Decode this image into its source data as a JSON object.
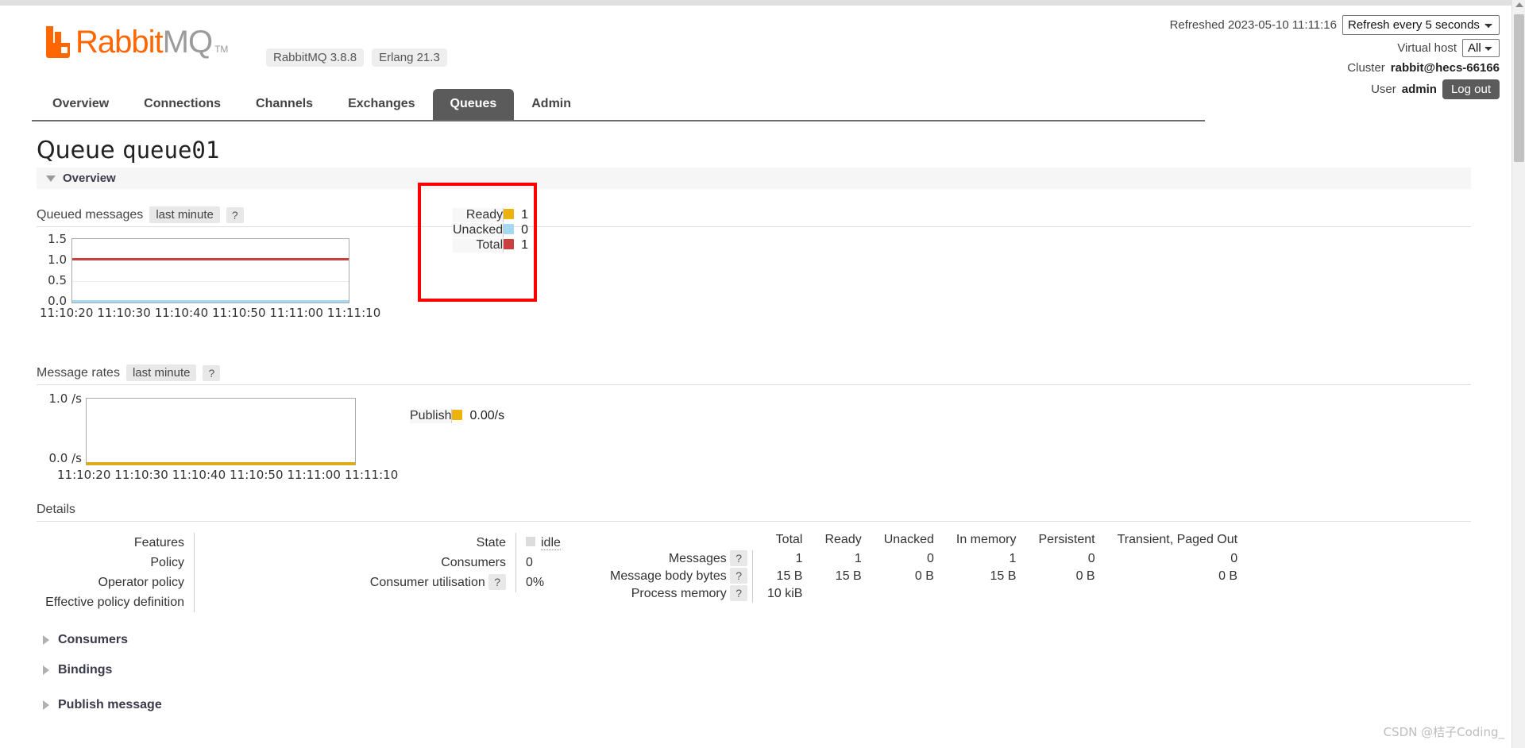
{
  "header": {
    "brand_rabbit": "Rabbit",
    "brand_mq": "MQ",
    "trademark": "TM",
    "version_pill": "RabbitMQ 3.8.8",
    "erlang_pill": "Erlang 21.3",
    "refreshed_label": "Refreshed 2023-05-10 11:11:16",
    "refresh_select_value": "Refresh every 5 seconds",
    "vhost_label": "Virtual host",
    "vhost_value": "All",
    "cluster_label": "Cluster",
    "cluster_value": "rabbit@hecs-66166",
    "user_label": "User",
    "user_value": "admin",
    "logout_label": "Log out"
  },
  "nav": {
    "tabs": [
      {
        "label": "Overview",
        "active": false
      },
      {
        "label": "Connections",
        "active": false
      },
      {
        "label": "Channels",
        "active": false
      },
      {
        "label": "Exchanges",
        "active": false
      },
      {
        "label": "Queues",
        "active": true
      },
      {
        "label": "Admin",
        "active": false
      }
    ]
  },
  "page": {
    "title_prefix": "Queue",
    "queue_name": "queue01",
    "overview_section": "Overview",
    "details_heading": "Details"
  },
  "queued_messages": {
    "title": "Queued messages",
    "range_tag": "last minute",
    "help": "?",
    "legend": [
      {
        "name": "Ready",
        "value": "1",
        "color": "#edb30d"
      },
      {
        "name": "Unacked",
        "value": "0",
        "color": "#a5d9f3"
      },
      {
        "name": "Total",
        "value": "1",
        "color": "#c9403f"
      }
    ]
  },
  "message_rates": {
    "title": "Message rates",
    "range_tag": "last minute",
    "help": "?",
    "legend": [
      {
        "name": "Publish",
        "value": "0.00/s",
        "color": "#edb30d"
      }
    ]
  },
  "details": {
    "left_labels": [
      "Features",
      "Policy",
      "Operator policy",
      "Effective policy definition"
    ],
    "left_values": [
      "",
      "",
      "",
      ""
    ],
    "mid_rows": [
      {
        "label": "State",
        "help": null,
        "value": "idle",
        "is_state": true
      },
      {
        "label": "Consumers",
        "help": null,
        "value": "0",
        "is_state": false
      },
      {
        "label": "Consumer utilisation",
        "help": "?",
        "value": "0%",
        "is_state": false
      }
    ],
    "messages_table": {
      "columns": [
        "Total",
        "Ready",
        "Unacked",
        "In memory",
        "Persistent",
        "Transient, Paged Out"
      ],
      "rows": [
        {
          "label": "Messages",
          "help": "?",
          "values": [
            "1",
            "1",
            "0",
            "1",
            "0",
            "0"
          ]
        },
        {
          "label": "Message body bytes",
          "help": "?",
          "values": [
            "15 B",
            "15 B",
            "0 B",
            "15 B",
            "0 B",
            "0 B"
          ]
        },
        {
          "label": "Process memory",
          "help": "?",
          "values": [
            "10 kiB",
            "",
            "",
            "",
            "",
            ""
          ]
        }
      ]
    }
  },
  "bottom_sections": [
    {
      "label": "Consumers"
    },
    {
      "label": "Bindings"
    },
    {
      "label": "Publish message"
    }
  ],
  "watermark": "CSDN @桔子Coding_",
  "chart_data": [
    {
      "type": "line",
      "title": "Queued messages",
      "subtitle": "last minute",
      "xlabel": "",
      "ylabel": "",
      "ylim": [
        0.0,
        1.5
      ],
      "yticks": [
        "1.5",
        "1.0",
        "0.5",
        "0.0"
      ],
      "x": [
        "11:10:20",
        "11:10:30",
        "11:10:40",
        "11:10:50",
        "11:11:00",
        "11:11:10"
      ],
      "grid": true,
      "legend_position": "right",
      "series": [
        {
          "name": "Ready",
          "color": "#edb30d",
          "values": [
            1,
            1,
            1,
            1,
            1,
            1
          ],
          "current": 1
        },
        {
          "name": "Unacked",
          "color": "#a5d9f3",
          "values": [
            0,
            0,
            0,
            0,
            0,
            0
          ],
          "current": 0
        },
        {
          "name": "Total",
          "color": "#c9403f",
          "values": [
            1,
            1,
            1,
            1,
            1,
            1
          ],
          "current": 1
        }
      ]
    },
    {
      "type": "line",
      "title": "Message rates",
      "subtitle": "last minute",
      "xlabel": "",
      "ylabel": "/s",
      "ylim": [
        0.0,
        1.0
      ],
      "yticks": [
        "1.0 /s",
        "0.0 /s"
      ],
      "x": [
        "11:10:20",
        "11:10:30",
        "11:10:40",
        "11:10:50",
        "11:11:00",
        "11:11:10"
      ],
      "grid": false,
      "legend_position": "right",
      "series": [
        {
          "name": "Publish",
          "color": "#edb30d",
          "values": [
            0,
            0,
            0,
            0,
            0,
            0
          ],
          "current": "0.00/s"
        }
      ]
    }
  ]
}
